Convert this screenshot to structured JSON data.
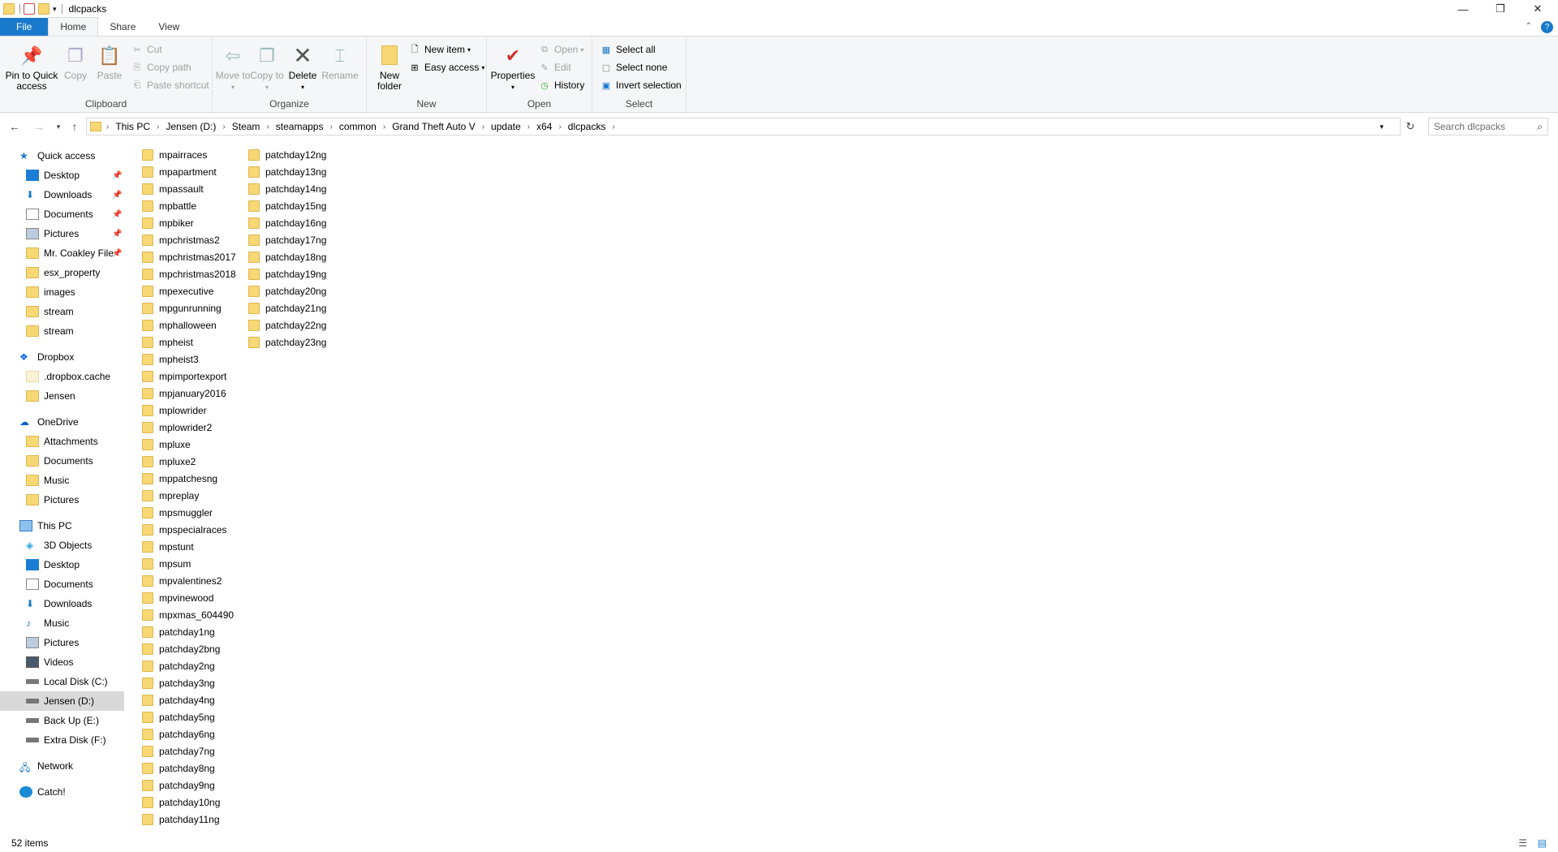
{
  "window": {
    "title": "dlcpacks",
    "minimize": "—",
    "maximize": "❐",
    "close": "✕"
  },
  "tabs": [
    "File",
    "Home",
    "Share",
    "View"
  ],
  "ribbon": {
    "clipboard": {
      "label": "Clipboard",
      "pin": "Pin to Quick access",
      "copy": "Copy",
      "paste": "Paste",
      "cut": "Cut",
      "copy_path": "Copy path",
      "paste_shortcut": "Paste shortcut"
    },
    "organize": {
      "label": "Organize",
      "move_to": "Move to",
      "copy_to": "Copy to",
      "delete": "Delete",
      "rename": "Rename"
    },
    "new": {
      "label": "New",
      "new_folder": "New folder",
      "new_item": "New item",
      "easy_access": "Easy access"
    },
    "open": {
      "label": "Open",
      "properties": "Properties",
      "open": "Open",
      "edit": "Edit",
      "history": "History"
    },
    "select": {
      "label": "Select",
      "select_all": "Select all",
      "select_none": "Select none",
      "invert": "Invert selection"
    }
  },
  "address": {
    "crumbs": [
      "This PC",
      "Jensen (D:)",
      "Steam",
      "steamapps",
      "common",
      "Grand Theft Auto V",
      "update",
      "x64",
      "dlcpacks"
    ],
    "search_placeholder": "Search dlcpacks"
  },
  "nav": {
    "quick_access": "Quick access",
    "quick_items": [
      "Desktop",
      "Downloads",
      "Documents",
      "Pictures",
      "Mr. Coakley File",
      "esx_property",
      "images",
      "stream",
      "stream"
    ],
    "dropbox": "Dropbox",
    "dropbox_items": [
      ".dropbox.cache",
      "Jensen"
    ],
    "onedrive": "OneDrive",
    "onedrive_items": [
      "Attachments",
      "Documents",
      "Music",
      "Pictures"
    ],
    "this_pc": "This PC",
    "pc_items": [
      "3D Objects",
      "Desktop",
      "Documents",
      "Downloads",
      "Music",
      "Pictures",
      "Videos",
      "Local Disk (C:)",
      "Jensen (D:)",
      "Back Up (E:)",
      "Extra Disk (F:)"
    ],
    "network": "Network",
    "catch": "Catch!"
  },
  "files": [
    "mpairraces",
    "mpapartment",
    "mpassault",
    "mpbattle",
    "mpbiker",
    "mpchristmas2",
    "mpchristmas2017",
    "mpchristmas2018",
    "mpexecutive",
    "mpgunrunning",
    "mphalloween",
    "mpheist",
    "mpheist3",
    "mpimportexport",
    "mpjanuary2016",
    "mplowrider",
    "mplowrider2",
    "mpluxe",
    "mpluxe2",
    "mppatchesng",
    "mpreplay",
    "mpsmuggler",
    "mpspecialraces",
    "mpstunt",
    "mpsum",
    "mpvalentines2",
    "mpvinewood",
    "mpxmas_604490",
    "patchday1ng",
    "patchday2bng",
    "patchday2ng",
    "patchday3ng",
    "patchday4ng",
    "patchday5ng",
    "patchday6ng",
    "patchday7ng",
    "patchday8ng",
    "patchday9ng",
    "patchday10ng",
    "patchday11ng",
    "patchday12ng",
    "patchday13ng",
    "patchday14ng",
    "patchday15ng",
    "patchday16ng",
    "patchday17ng",
    "patchday18ng",
    "patchday19ng",
    "patchday20ng",
    "patchday21ng",
    "patchday22ng",
    "patchday23ng"
  ],
  "status": {
    "count": "52 items"
  },
  "colors": {
    "accent": "#1979ca",
    "folder": "#f8d775",
    "selected": "#d9d9d9"
  }
}
